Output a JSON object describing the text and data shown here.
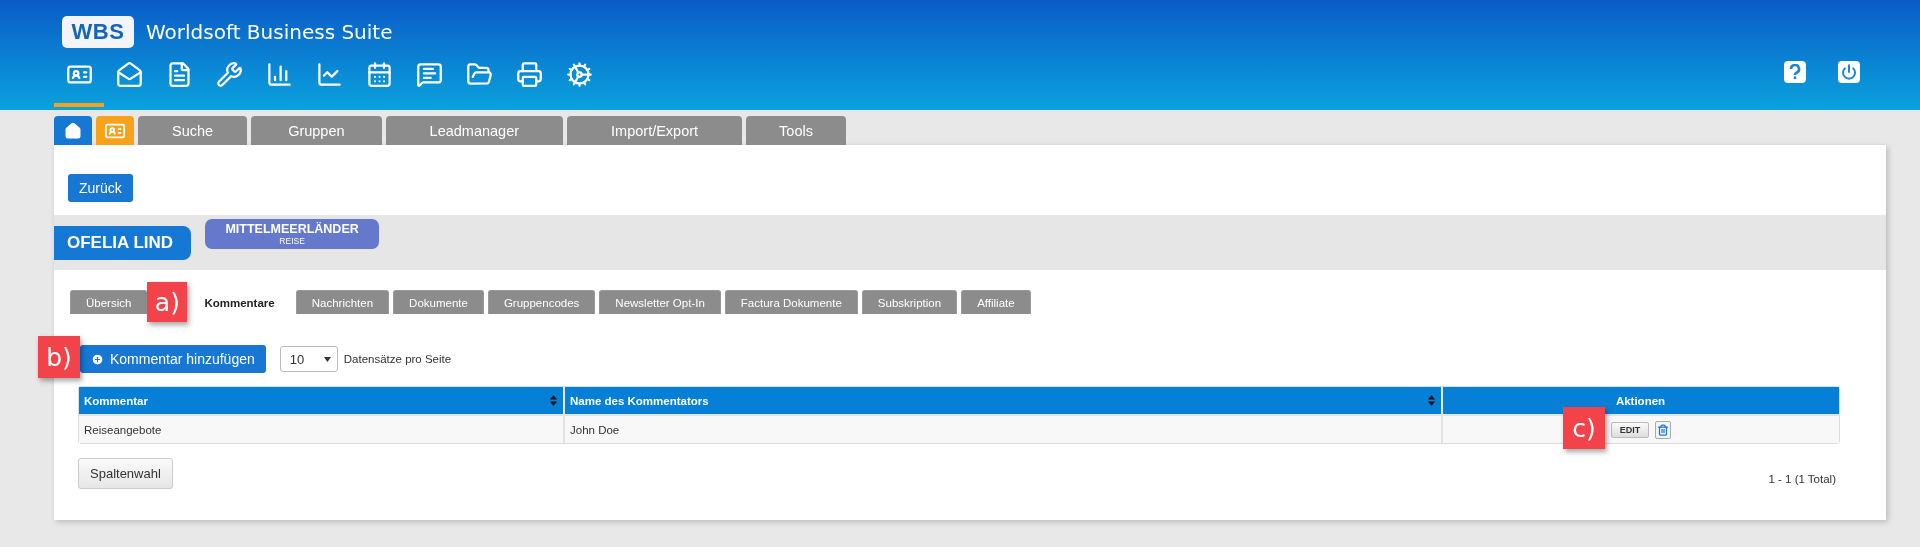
{
  "header": {
    "logo": "WBS",
    "title": "Worldsoft Business Suite",
    "modules": [
      {
        "selected": true
      },
      {
        "selected": false
      },
      {
        "selected": false
      },
      {
        "selected": false
      },
      {
        "selected": false
      },
      {
        "selected": false
      },
      {
        "selected": false
      },
      {
        "selected": false
      },
      {
        "selected": false
      },
      {
        "selected": false
      },
      {
        "selected": false
      }
    ]
  },
  "main_tabs": [
    {
      "kind": "home",
      "selected": false
    },
    {
      "kind": "contact",
      "selected": true
    },
    {
      "kind": "text",
      "label": "Suche",
      "selected": false
    },
    {
      "kind": "text",
      "label": "Gruppen",
      "selected": false
    },
    {
      "kind": "text",
      "label": "Leadmanager",
      "selected": false
    },
    {
      "kind": "text",
      "label": "Import/Export",
      "selected": false
    },
    {
      "kind": "text",
      "label": "Tools",
      "selected": false
    }
  ],
  "back_button": "Zurück",
  "contact": {
    "name": "OFELIA LIND",
    "group": {
      "name": "MITTELMEERLÄNDER",
      "category": "REISE"
    }
  },
  "sub_tabs": [
    {
      "label": "Übersich",
      "selected": false
    },
    {
      "label": "Kommentare",
      "selected": true
    },
    {
      "label": "Nachrichten",
      "selected": false
    },
    {
      "label": "Dokumente",
      "selected": false
    },
    {
      "label": "Gruppencodes",
      "selected": false
    },
    {
      "label": "Newsletter Opt-In",
      "selected": false
    },
    {
      "label": "Factura Dokumente",
      "selected": false
    },
    {
      "label": "Subskription",
      "selected": false
    },
    {
      "label": "Affiliate",
      "selected": false
    }
  ],
  "annotations": [
    "a)",
    "b)",
    "c)"
  ],
  "toolbar": {
    "add_button": "Kommentar hinzufügen",
    "page_size": "10",
    "page_size_label": "Datensätze pro Seite"
  },
  "table": {
    "columns": [
      {
        "label": "Kommentar",
        "sortable": true
      },
      {
        "label": "Name des Kommentators",
        "sortable": true
      },
      {
        "label": "Aktionen",
        "sortable": false
      }
    ],
    "rows": [
      {
        "cells": [
          "Reiseangebote",
          "John Doe"
        ],
        "edit_button": "EDIT"
      }
    ]
  },
  "column_button": "Spaltenwahl",
  "pagination": "1 - 1 (1 Total)"
}
